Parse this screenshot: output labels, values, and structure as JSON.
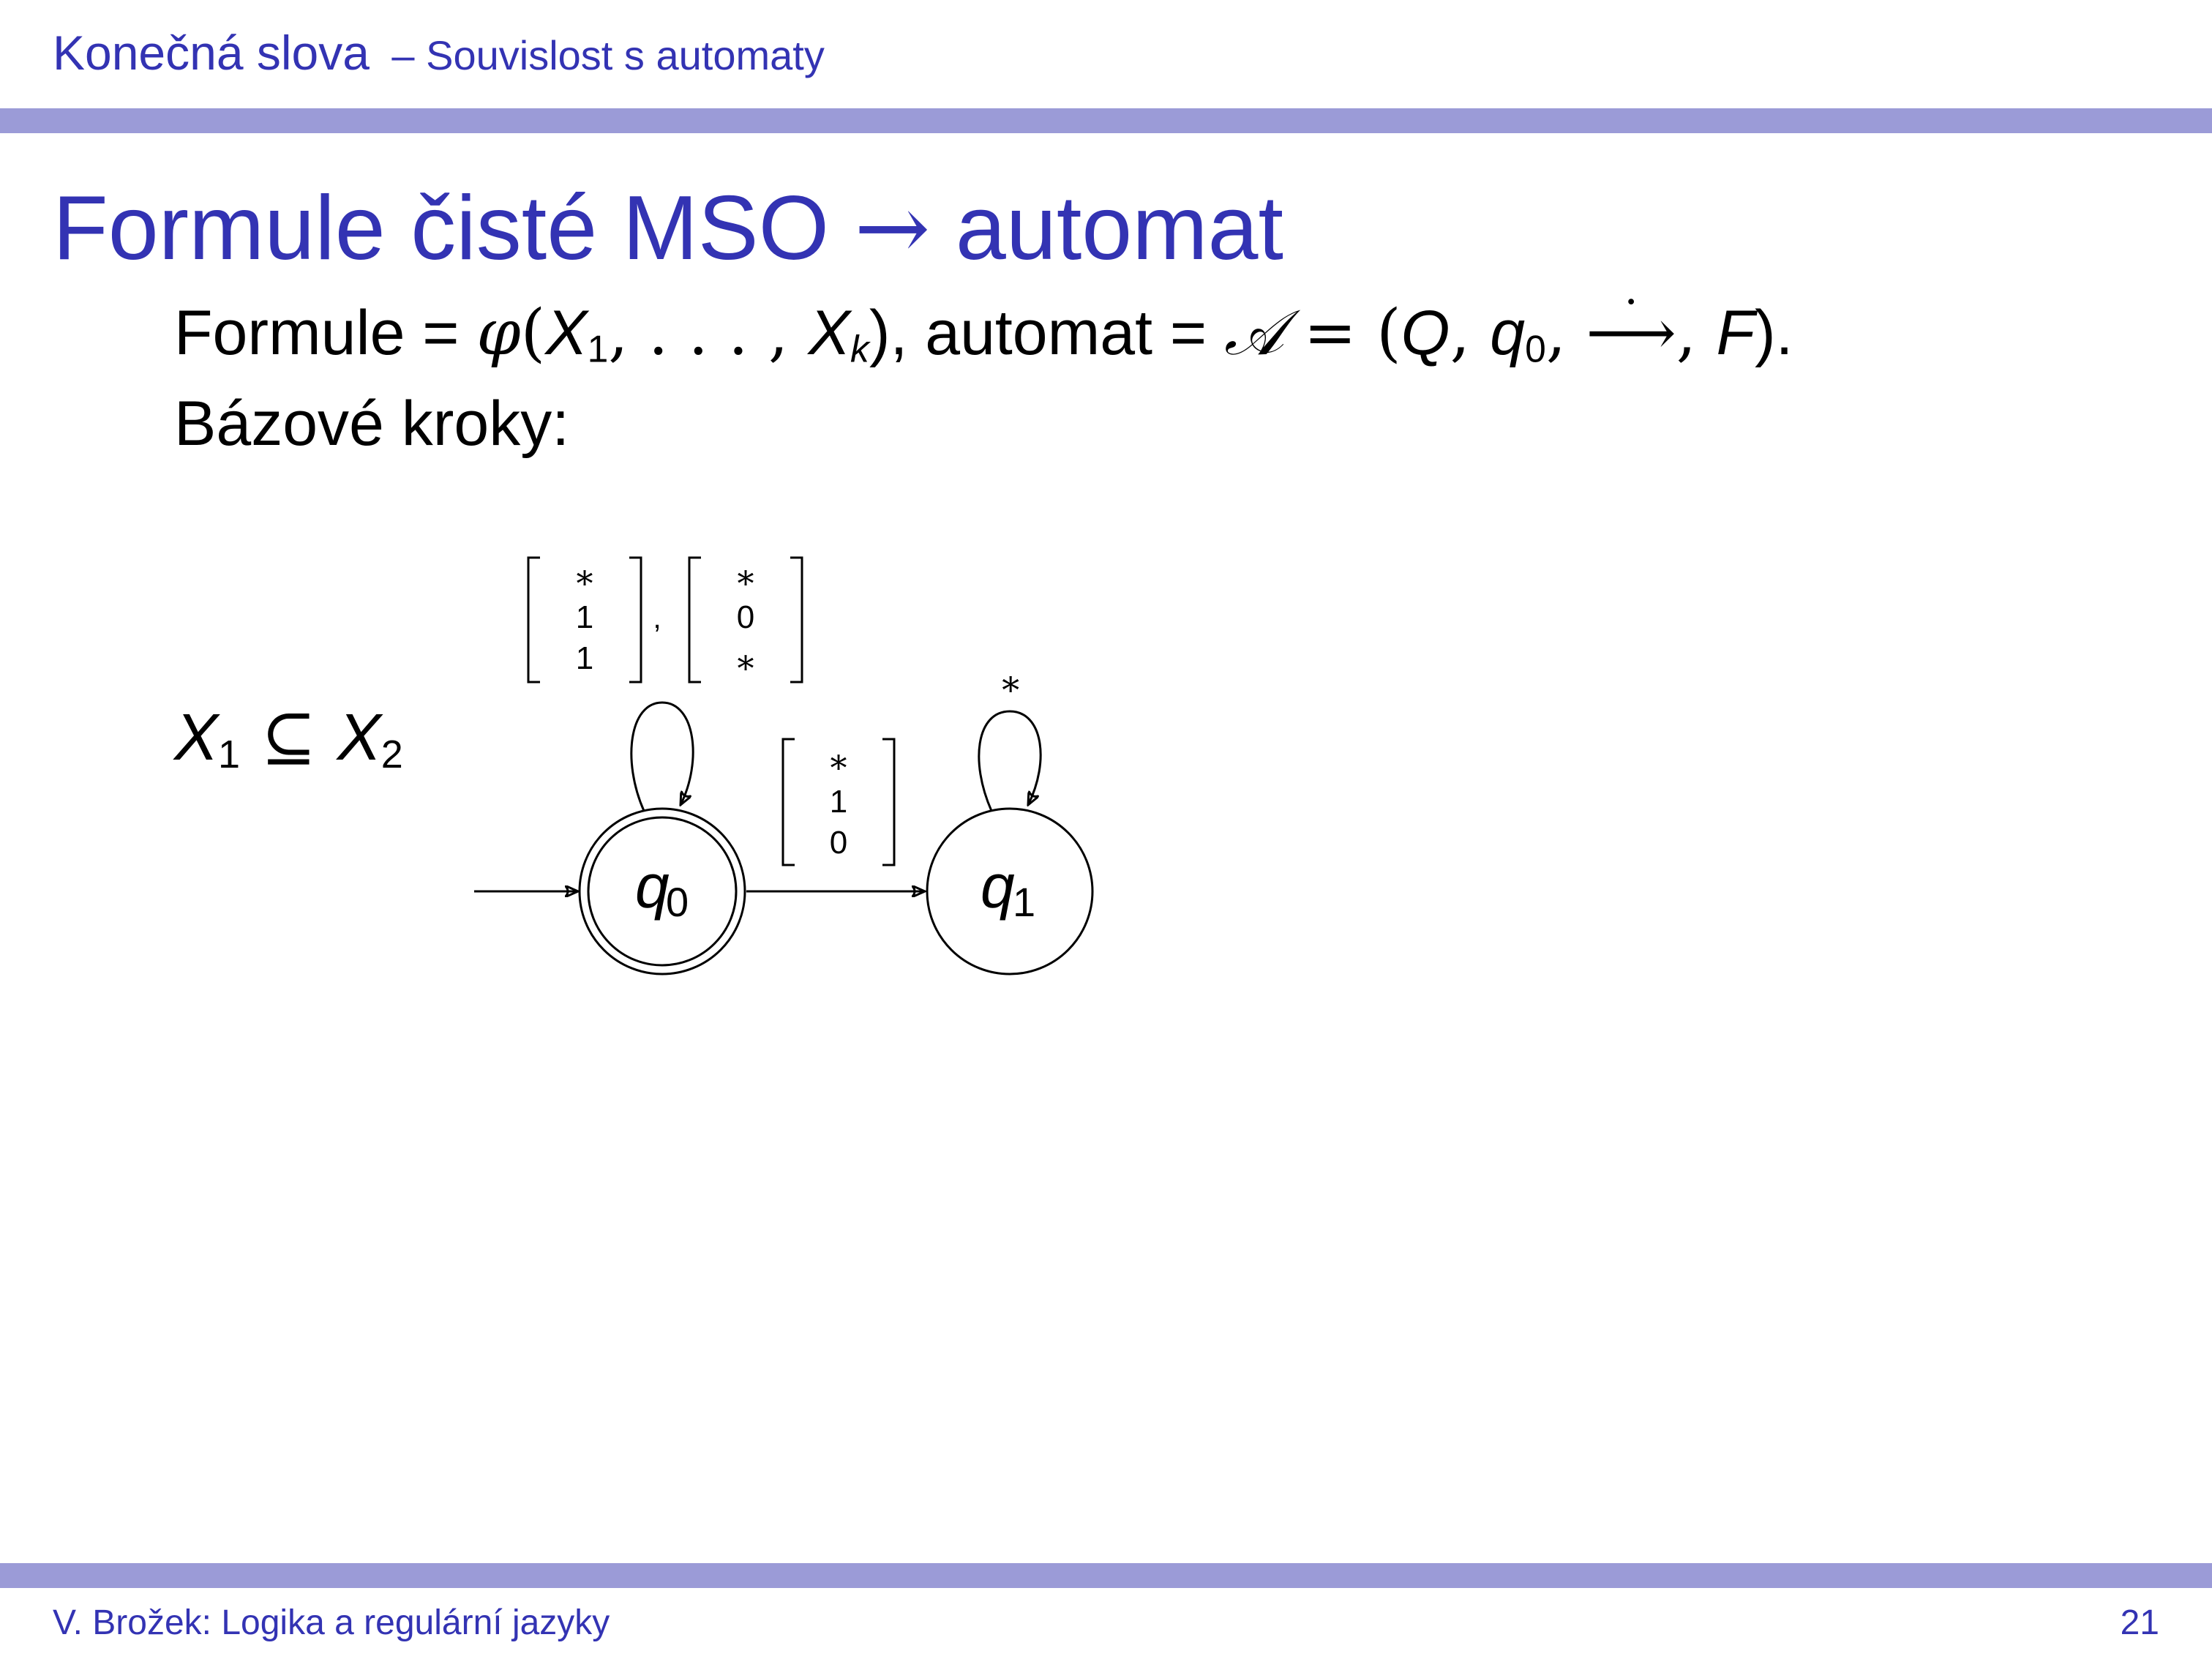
{
  "header": {
    "section": "Konečná slova",
    "subsection": "– Souvislost s automaty"
  },
  "frame": {
    "title_text": "Formule čisté MSO",
    "title_arrow": "→",
    "title_tail": "automat"
  },
  "body": {
    "line1": {
      "formule_label": "Formule = ",
      "phi": "φ",
      "X": "X",
      "sub1": "1",
      "dots": ", . . . , ",
      "subk": "k",
      "automat_label": "), automat = ",
      "A": "𝒜",
      "eq": " = (",
      "Q": "Q",
      "comma": ", ",
      "q": "q",
      "sub0": "0",
      "arrow": "⟶",
      "dot": "·",
      "F": "F",
      "end": ")."
    },
    "line2": "Bázové kroky:"
  },
  "formula": {
    "X": "X",
    "sub1": "1",
    "op": " ⊆ ",
    "sub2": "2"
  },
  "automaton": {
    "states": [
      {
        "label": "q",
        "sub": "0",
        "accepting": true,
        "initial": true
      },
      {
        "label": "q",
        "sub": "1",
        "accepting": false,
        "initial": false
      }
    ],
    "loop_q0_labels": [
      [
        "∗",
        "1",
        "1"
      ],
      [
        "∗",
        "0",
        "∗"
      ]
    ],
    "loop_q0_separator": ",",
    "edge_q0_q1_label": [
      "∗",
      "1",
      "0"
    ],
    "loop_q1_label": "∗"
  },
  "footer": {
    "left": "V. Brožek: Logika a regulární jazyky",
    "page": "21"
  },
  "colors": {
    "theme": "#3333b3",
    "bar": "#9b9bd7"
  }
}
